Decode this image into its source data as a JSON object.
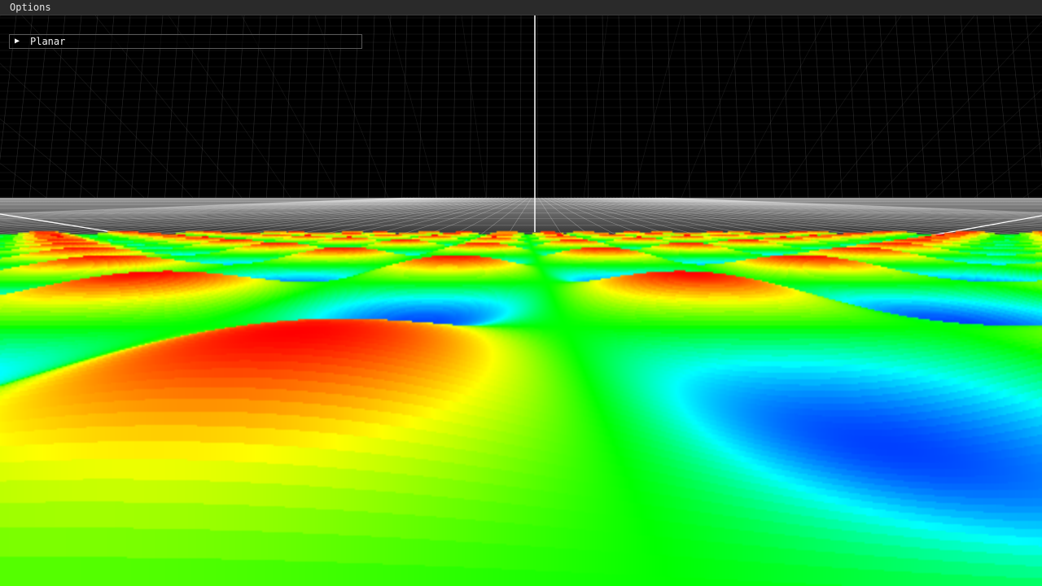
{
  "menu": {
    "options_label": "Options"
  },
  "panel": {
    "header_label": "Planar",
    "expand_icon": "triangle-right-icon",
    "collapsed": true
  },
  "scene": {
    "background_color": "#000000",
    "grid_color": "#ffffff",
    "axis_color": "#ffffff",
    "surface_colormap": [
      "#0040ff",
      "#00ffff",
      "#00ff00",
      "#ffff00",
      "#ff0000"
    ]
  }
}
